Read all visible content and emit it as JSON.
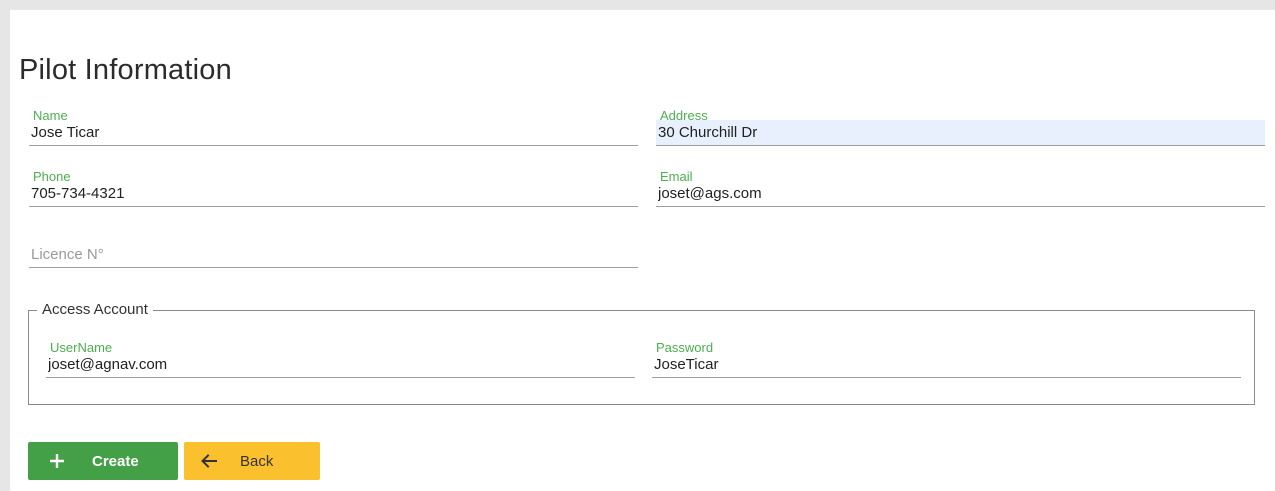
{
  "page": {
    "title": "Pilot Information"
  },
  "form": {
    "name": {
      "label": "Name",
      "value": "Jose Ticar"
    },
    "address": {
      "label": "Address",
      "value": "30 Churchill Dr"
    },
    "phone": {
      "label": "Phone",
      "value": "705-734-4321"
    },
    "email": {
      "label": "Email",
      "value": "joset@ags.com"
    },
    "licence": {
      "placeholder": "Licence N°",
      "value": ""
    }
  },
  "access_account": {
    "legend": "Access Account",
    "username": {
      "label": "UserName",
      "value": "joset@agnav.com"
    },
    "password": {
      "label": "Password",
      "value": "JoseTicar"
    }
  },
  "actions": {
    "create": {
      "label": "Create",
      "icon": "plus-icon"
    },
    "back": {
      "label": "Back",
      "icon": "arrow-left-icon"
    }
  },
  "colors": {
    "accent_green": "#4caf50",
    "create_button": "#43a047",
    "back_button": "#fbc02d",
    "autofill_highlight": "#e8f0fe"
  }
}
